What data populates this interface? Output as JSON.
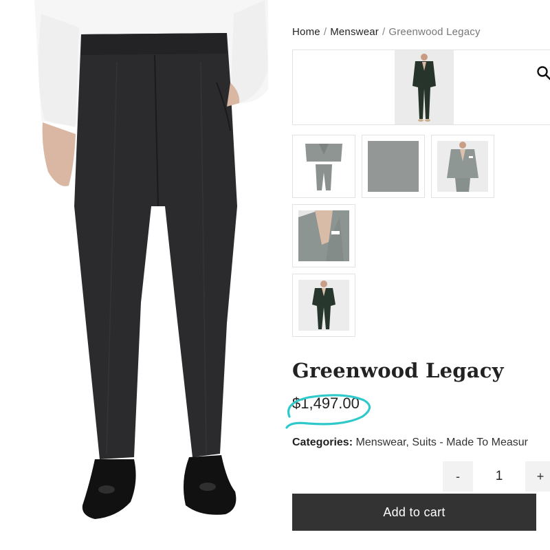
{
  "breadcrumb": {
    "home": "Home",
    "separator": "/",
    "category": "Menswear",
    "current": "Greenwood Legacy"
  },
  "product": {
    "title": "Greenwood Legacy",
    "price": "$1,497.00",
    "categories_label": "Categories:",
    "categories": [
      "Menswear",
      "Suits - Made To Measur"
    ],
    "category_separator": ","
  },
  "gallery": {
    "zoom_icon": "search-icon",
    "thumbnails": [
      "suit-flat",
      "fabric-swatch",
      "model-grey-suit",
      "jacket-closeup",
      "model-green-suit"
    ]
  },
  "cart": {
    "minus_label": "-",
    "quantity": "1",
    "plus_label": "+",
    "add_label": "Add to cart"
  },
  "colors": {
    "accent_circle": "#2fc9cc",
    "button_bg": "#333333"
  }
}
